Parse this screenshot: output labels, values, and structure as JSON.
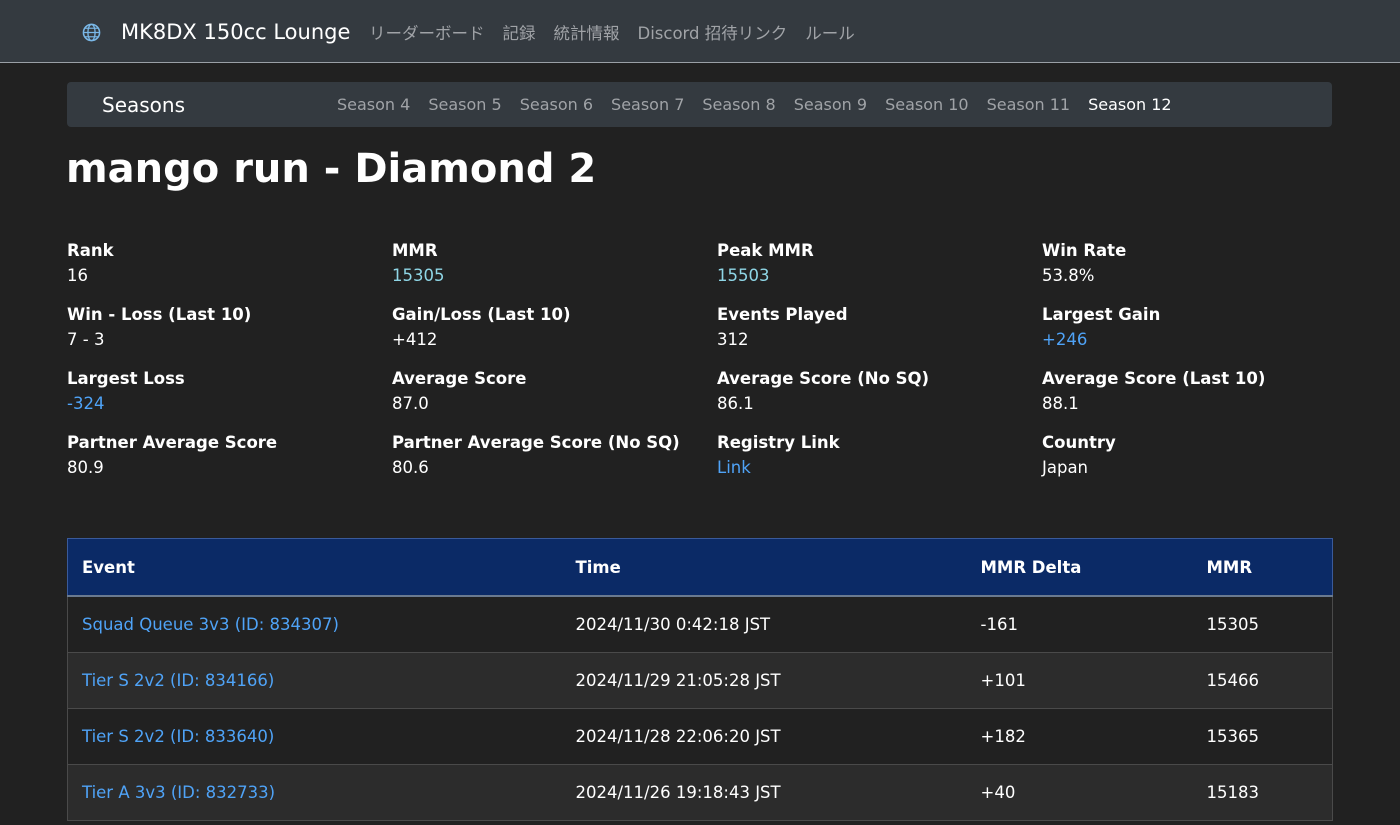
{
  "navbar": {
    "brand": "MK8DX 150cc Lounge",
    "links": [
      "リーダーボード",
      "記録",
      "統計情報",
      "Discord 招待リンク",
      "ルール"
    ]
  },
  "seasons": {
    "title": "Seasons",
    "items": [
      "Season 4",
      "Season 5",
      "Season 6",
      "Season 7",
      "Season 8",
      "Season 9",
      "Season 10",
      "Season 11",
      "Season 12"
    ],
    "active": "Season 12"
  },
  "player": {
    "title": "mango run - Diamond 2"
  },
  "stats": [
    {
      "label": "Rank",
      "value": "16"
    },
    {
      "label": "MMR",
      "value": "15305"
    },
    {
      "label": "Peak MMR",
      "value": "15503"
    },
    {
      "label": "Win Rate",
      "value": "53.8%"
    },
    {
      "label": "Win - Loss (Last 10)",
      "value": "7 - 3"
    },
    {
      "label": "Gain/Loss (Last 10)",
      "value": "+412"
    },
    {
      "label": "Events Played",
      "value": "312"
    },
    {
      "label": "Largest Gain",
      "value": "+246"
    },
    {
      "label": "Largest Loss",
      "value": "-324"
    },
    {
      "label": "Average Score",
      "value": "87.0"
    },
    {
      "label": "Average Score (No SQ)",
      "value": "86.1"
    },
    {
      "label": "Average Score (Last 10)",
      "value": "88.1"
    },
    {
      "label": "Partner Average Score",
      "value": "80.9"
    },
    {
      "label": "Partner Average Score (No SQ)",
      "value": "80.6"
    },
    {
      "label": "Registry Link",
      "value": "Link"
    },
    {
      "label": "Country",
      "value": "Japan"
    }
  ],
  "table": {
    "headers": [
      "Event",
      "Time",
      "MMR Delta",
      "MMR"
    ],
    "rows": [
      {
        "event": "Squad Queue 3v3 (ID: 834307)",
        "time": "2024/11/30 0:42:18 JST",
        "delta": "-161",
        "mmr": "15305"
      },
      {
        "event": "Tier S 2v2 (ID: 834166)",
        "time": "2024/11/29 21:05:28 JST",
        "delta": "+101",
        "mmr": "15466"
      },
      {
        "event": "Tier S 2v2 (ID: 833640)",
        "time": "2024/11/28 22:06:20 JST",
        "delta": "+182",
        "mmr": "15365"
      },
      {
        "event": "Tier A 3v3 (ID: 832733)",
        "time": "2024/11/26 19:18:43 JST",
        "delta": "+40",
        "mmr": "15183"
      }
    ]
  },
  "colors": {
    "background": "#212121",
    "navbar": "#343a40",
    "table_header": "#0b2a66",
    "link_blue": "#4fa3f7",
    "mmr_teal": "#8fd6e6"
  }
}
